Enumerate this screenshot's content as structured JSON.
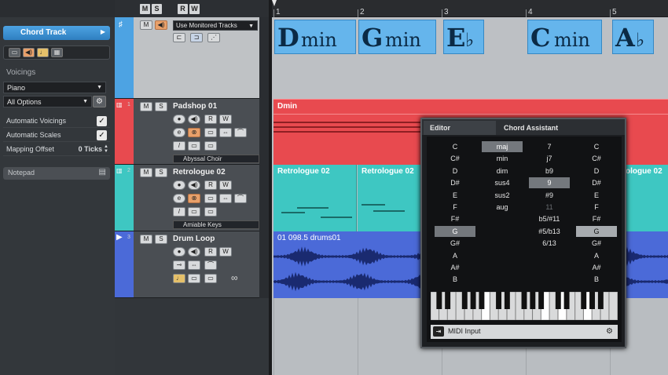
{
  "inspector": {
    "chord_track_title": "Chord Track",
    "voicings_header": "Voicings",
    "voicing_instrument": "Piano",
    "voicing_options": "All Options",
    "automatic_voicings": "Automatic Voicings",
    "automatic_scales": "Automatic Scales",
    "mapping_offset_label": "Mapping Offset",
    "mapping_offset_value": "0 Ticks",
    "notepad": "Notepad"
  },
  "top_buttons": {
    "m": "M",
    "s": "S",
    "r": "R",
    "w": "W"
  },
  "tracks": [
    {
      "name": "Use Monitored Tracks",
      "type": "chord"
    },
    {
      "num": "1",
      "name": "Padshop 01",
      "insert": "Abyssal Choir",
      "m": "M",
      "s": "S",
      "r": "R",
      "w": "W"
    },
    {
      "num": "2",
      "name": "Retrologue 02",
      "insert": "Amiable Keys",
      "m": "M",
      "s": "S",
      "r": "R",
      "w": "W"
    },
    {
      "num": "3",
      "name": "Drum Loop",
      "m": "M",
      "s": "S",
      "r": "R",
      "w": "W"
    }
  ],
  "ruler": {
    "bars": [
      "1",
      "2",
      "3",
      "4",
      "5"
    ]
  },
  "chords": [
    {
      "root": "D",
      "quality": "min"
    },
    {
      "root": "G",
      "quality": "min"
    },
    {
      "root": "E",
      "quality": "♭"
    },
    {
      "root": "C",
      "quality": "min"
    },
    {
      "root": "A",
      "quality": "♭"
    }
  ],
  "parts": {
    "padshop": "Dmin",
    "retro1": "Retrologue 02",
    "retro2": "Retrologue 02",
    "retro3": "ologue 02",
    "drums": "01 098.5 drums01"
  },
  "chord_editor": {
    "tab_editor": "Editor",
    "tab_assistant": "Chord Assistant",
    "roots": [
      "C",
      "C#",
      "D",
      "D#",
      "E",
      "F",
      "F#",
      "G",
      "G#",
      "A",
      "A#",
      "B"
    ],
    "selected_root": "G",
    "types": [
      "maj",
      "min",
      "dim",
      "sus4",
      "sus2",
      "aug"
    ],
    "selected_type": "maj",
    "tensions": [
      "7",
      "j7",
      "b9",
      "9",
      "#9",
      "11",
      "b5/#11",
      "#5/b13",
      "6/13"
    ],
    "selected_tension": "9",
    "bass": [
      "C",
      "C#",
      "D",
      "D#",
      "E",
      "F",
      "F#",
      "G",
      "G#",
      "A",
      "A#",
      "B"
    ],
    "selected_bass": "G",
    "midi_input": "MIDI Input"
  },
  "colors": {
    "chord_track": "#4da3e3",
    "padshop": "#e84a4f",
    "retrologue": "#3ec7c2",
    "drums": "#4b6ad8",
    "chord_block": "#65b5ec"
  }
}
